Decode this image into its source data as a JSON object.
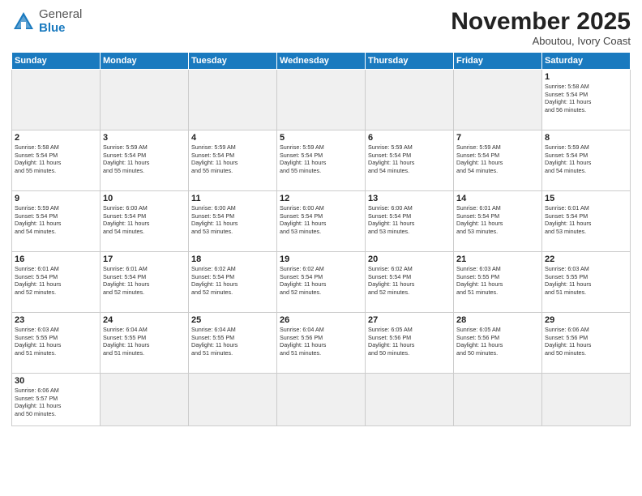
{
  "logo": {
    "general": "General",
    "blue": "Blue"
  },
  "header": {
    "month": "November 2025",
    "location": "Aboutou, Ivory Coast"
  },
  "weekdays": [
    "Sunday",
    "Monday",
    "Tuesday",
    "Wednesday",
    "Thursday",
    "Friday",
    "Saturday"
  ],
  "days": [
    {
      "num": "",
      "info": "",
      "empty": true
    },
    {
      "num": "",
      "info": "",
      "empty": true
    },
    {
      "num": "",
      "info": "",
      "empty": true
    },
    {
      "num": "",
      "info": "",
      "empty": true
    },
    {
      "num": "",
      "info": "",
      "empty": true
    },
    {
      "num": "",
      "info": "",
      "empty": true
    },
    {
      "num": "1",
      "info": "Sunrise: 5:58 AM\nSunset: 5:54 PM\nDaylight: 11 hours\nand 56 minutes.",
      "empty": false
    },
    {
      "num": "2",
      "info": "Sunrise: 5:58 AM\nSunset: 5:54 PM\nDaylight: 11 hours\nand 55 minutes.",
      "empty": false
    },
    {
      "num": "3",
      "info": "Sunrise: 5:59 AM\nSunset: 5:54 PM\nDaylight: 11 hours\nand 55 minutes.",
      "empty": false
    },
    {
      "num": "4",
      "info": "Sunrise: 5:59 AM\nSunset: 5:54 PM\nDaylight: 11 hours\nand 55 minutes.",
      "empty": false
    },
    {
      "num": "5",
      "info": "Sunrise: 5:59 AM\nSunset: 5:54 PM\nDaylight: 11 hours\nand 55 minutes.",
      "empty": false
    },
    {
      "num": "6",
      "info": "Sunrise: 5:59 AM\nSunset: 5:54 PM\nDaylight: 11 hours\nand 54 minutes.",
      "empty": false
    },
    {
      "num": "7",
      "info": "Sunrise: 5:59 AM\nSunset: 5:54 PM\nDaylight: 11 hours\nand 54 minutes.",
      "empty": false
    },
    {
      "num": "8",
      "info": "Sunrise: 5:59 AM\nSunset: 5:54 PM\nDaylight: 11 hours\nand 54 minutes.",
      "empty": false
    },
    {
      "num": "9",
      "info": "Sunrise: 5:59 AM\nSunset: 5:54 PM\nDaylight: 11 hours\nand 54 minutes.",
      "empty": false
    },
    {
      "num": "10",
      "info": "Sunrise: 6:00 AM\nSunset: 5:54 PM\nDaylight: 11 hours\nand 54 minutes.",
      "empty": false
    },
    {
      "num": "11",
      "info": "Sunrise: 6:00 AM\nSunset: 5:54 PM\nDaylight: 11 hours\nand 53 minutes.",
      "empty": false
    },
    {
      "num": "12",
      "info": "Sunrise: 6:00 AM\nSunset: 5:54 PM\nDaylight: 11 hours\nand 53 minutes.",
      "empty": false
    },
    {
      "num": "13",
      "info": "Sunrise: 6:00 AM\nSunset: 5:54 PM\nDaylight: 11 hours\nand 53 minutes.",
      "empty": false
    },
    {
      "num": "14",
      "info": "Sunrise: 6:01 AM\nSunset: 5:54 PM\nDaylight: 11 hours\nand 53 minutes.",
      "empty": false
    },
    {
      "num": "15",
      "info": "Sunrise: 6:01 AM\nSunset: 5:54 PM\nDaylight: 11 hours\nand 53 minutes.",
      "empty": false
    },
    {
      "num": "16",
      "info": "Sunrise: 6:01 AM\nSunset: 5:54 PM\nDaylight: 11 hours\nand 52 minutes.",
      "empty": false
    },
    {
      "num": "17",
      "info": "Sunrise: 6:01 AM\nSunset: 5:54 PM\nDaylight: 11 hours\nand 52 minutes.",
      "empty": false
    },
    {
      "num": "18",
      "info": "Sunrise: 6:02 AM\nSunset: 5:54 PM\nDaylight: 11 hours\nand 52 minutes.",
      "empty": false
    },
    {
      "num": "19",
      "info": "Sunrise: 6:02 AM\nSunset: 5:54 PM\nDaylight: 11 hours\nand 52 minutes.",
      "empty": false
    },
    {
      "num": "20",
      "info": "Sunrise: 6:02 AM\nSunset: 5:54 PM\nDaylight: 11 hours\nand 52 minutes.",
      "empty": false
    },
    {
      "num": "21",
      "info": "Sunrise: 6:03 AM\nSunset: 5:55 PM\nDaylight: 11 hours\nand 51 minutes.",
      "empty": false
    },
    {
      "num": "22",
      "info": "Sunrise: 6:03 AM\nSunset: 5:55 PM\nDaylight: 11 hours\nand 51 minutes.",
      "empty": false
    },
    {
      "num": "23",
      "info": "Sunrise: 6:03 AM\nSunset: 5:55 PM\nDaylight: 11 hours\nand 51 minutes.",
      "empty": false
    },
    {
      "num": "24",
      "info": "Sunrise: 6:04 AM\nSunset: 5:55 PM\nDaylight: 11 hours\nand 51 minutes.",
      "empty": false
    },
    {
      "num": "25",
      "info": "Sunrise: 6:04 AM\nSunset: 5:55 PM\nDaylight: 11 hours\nand 51 minutes.",
      "empty": false
    },
    {
      "num": "26",
      "info": "Sunrise: 6:04 AM\nSunset: 5:56 PM\nDaylight: 11 hours\nand 51 minutes.",
      "empty": false
    },
    {
      "num": "27",
      "info": "Sunrise: 6:05 AM\nSunset: 5:56 PM\nDaylight: 11 hours\nand 50 minutes.",
      "empty": false
    },
    {
      "num": "28",
      "info": "Sunrise: 6:05 AM\nSunset: 5:56 PM\nDaylight: 11 hours\nand 50 minutes.",
      "empty": false
    },
    {
      "num": "29",
      "info": "Sunrise: 6:06 AM\nSunset: 5:56 PM\nDaylight: 11 hours\nand 50 minutes.",
      "empty": false
    },
    {
      "num": "30",
      "info": "Sunrise: 6:06 AM\nSunset: 5:57 PM\nDaylight: 11 hours\nand 50 minutes.",
      "empty": false
    },
    {
      "num": "",
      "info": "",
      "empty": true
    },
    {
      "num": "",
      "info": "",
      "empty": true
    },
    {
      "num": "",
      "info": "",
      "empty": true
    },
    {
      "num": "",
      "info": "",
      "empty": true
    },
    {
      "num": "",
      "info": "",
      "empty": true
    },
    {
      "num": "",
      "info": "",
      "empty": true
    }
  ]
}
